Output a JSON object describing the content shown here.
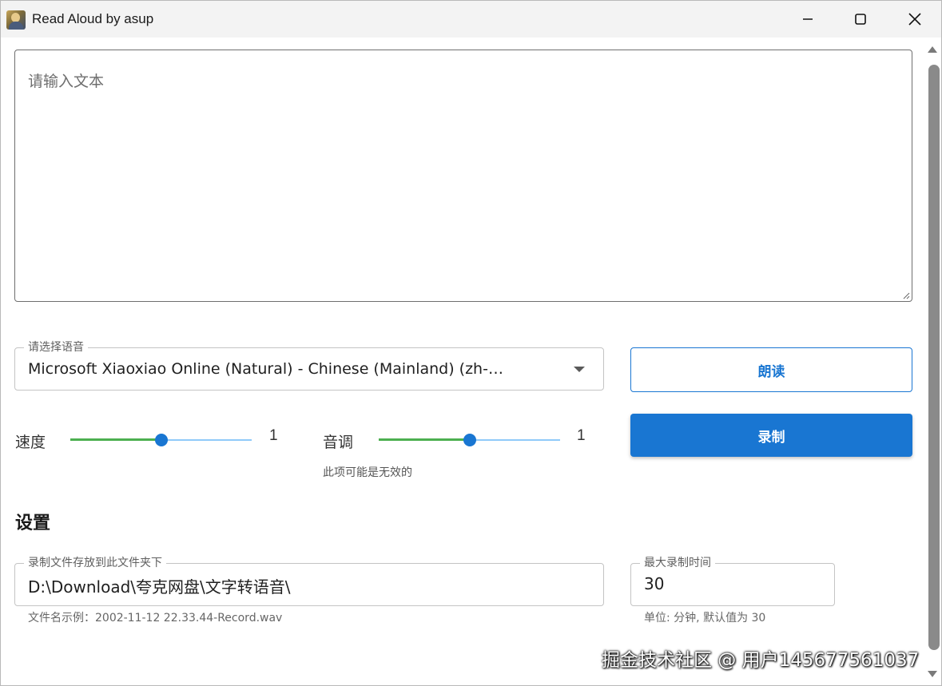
{
  "window": {
    "title": "Read Aloud by asup",
    "icon": "avatar-icon",
    "controls": [
      "minimize-icon",
      "maximize-icon",
      "close-icon"
    ]
  },
  "text_input": {
    "placeholder": "请输入文本",
    "value": ""
  },
  "voice": {
    "label": "请选择语音",
    "selected": "Microsoft Xiaoxiao Online (Natural) - Chinese (Mainland) (zh-…"
  },
  "buttons": {
    "read": "朗读",
    "record": "录制"
  },
  "speed": {
    "label": "速度",
    "value": "1",
    "position": 0.5
  },
  "pitch": {
    "label": "音调",
    "value": "1",
    "position": 0.5,
    "hint": "此项可能是无效的"
  },
  "settings": {
    "title": "设置",
    "folder_label": "录制文件存放到此文件夹下",
    "folder_value": "D:\\Download\\夸克网盘\\文字转语音\\",
    "filename_example": "文件名示例：2002-11-12 22.33.44-Record.wav",
    "max_label": "最大录制时间",
    "max_value": "30",
    "max_helper": "单位: 分钟, 默认值为 30"
  },
  "watermark": "掘金技术社区 @ 用户145677561037",
  "colors": {
    "primary": "#1976d2",
    "slider_track": "#4caf50",
    "slider_rail": "#90caf9"
  }
}
